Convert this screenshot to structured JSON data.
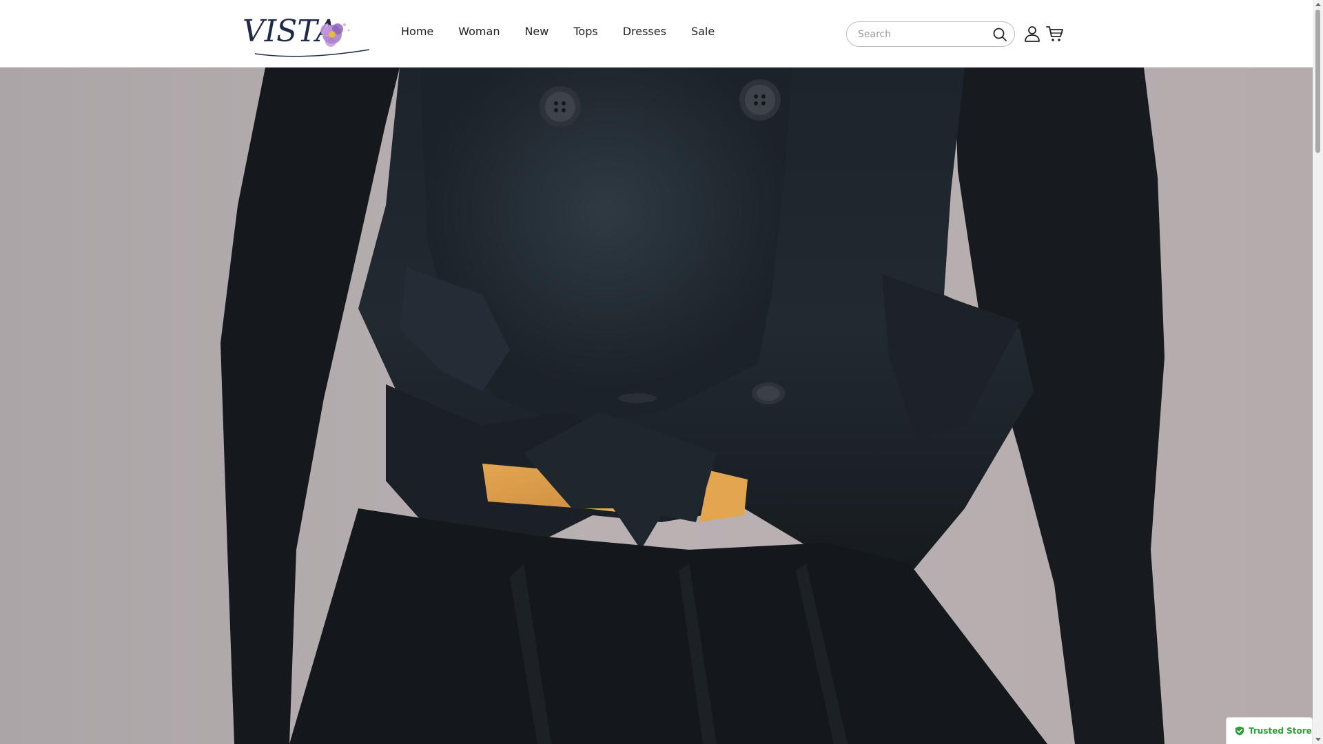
{
  "brand": {
    "logo_text": "VISTA",
    "logo_icon": "flower-icon"
  },
  "nav": {
    "items": [
      {
        "label": "Home"
      },
      {
        "label": "Woman"
      },
      {
        "label": "New"
      },
      {
        "label": "Tops"
      },
      {
        "label": "Dresses"
      },
      {
        "label": "Sale"
      }
    ]
  },
  "search": {
    "placeholder": "Search",
    "value": "",
    "icon": "search-icon"
  },
  "header_icons": {
    "account": "user-icon",
    "cart": "cart-icon"
  },
  "hero": {
    "image_name": "hero-image"
  },
  "trusted_badge": {
    "label": "Trusted Store",
    "icon": "shield-check-icon",
    "color": "#2e9c3a"
  },
  "colors": {
    "header_bg": "#ffffff",
    "nav_text": "#222222",
    "hero_background": "#b5adae",
    "garment": "#1a1f24",
    "belt": "#e0a04e"
  }
}
